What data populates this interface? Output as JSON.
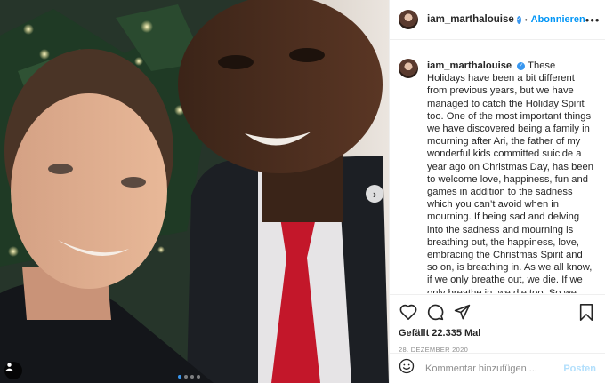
{
  "account": {
    "username": "iam_marthalouise",
    "separator": "•",
    "follow_label": "Abonnieren",
    "more_label": "•••"
  },
  "caption": {
    "username": "iam_marthalouise",
    "text": "These Holidays have been a bit different from previous years, but we have managed to catch the Holiday Spirit too. One of the most important things we have discovered being a family in mourning after Ari, the father of my wonderful kids committed suicide a year ago on Christmas Day, has been to welcome love, happiness, fun and games in addition to the sadness which you can’t avoid when in mourning. If being sad and delving into the sadness and mourning is breathing out, the happiness, love, embracing the Christmas Spirit and so on, is breathing in. As we all know, if we only breathe out, we die. If we only breathe in, we die too. So we need this balance of the two and to let yourself"
  },
  "actions": {
    "icons": [
      "heart-icon",
      "comment-icon",
      "share-icon",
      "bookmark-icon"
    ],
    "likes_label": "Gefällt 22.335 Mal",
    "date": "28. DEZEMBER 2020"
  },
  "comment": {
    "placeholder": "Kommentar hinzufügen ...",
    "post_label": "Posten"
  },
  "carousel": {
    "next_label": "›",
    "total_slides": 4,
    "active_slide": 1
  },
  "colors": {
    "accent": "#0095f6",
    "verified": "#3897f0",
    "muted": "#8e8e8e",
    "post_disabled": "#b2dffc"
  }
}
